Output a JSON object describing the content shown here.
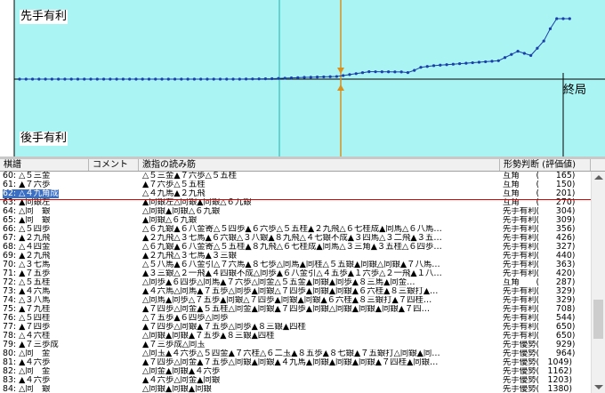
{
  "graph": {
    "top_label": "先手有利",
    "bottom_label": "後手有利",
    "end_label": "終局",
    "colors": {
      "plot_bg": "#aaf4f4",
      "line": "#1a3fa8",
      "marker": "#c84a10",
      "current": "#d8901e",
      "border": "#000000"
    }
  },
  "chart_data": {
    "type": "line",
    "x": [
      1,
      5,
      10,
      15,
      20,
      25,
      30,
      35,
      40,
      45,
      50,
      55,
      60,
      61,
      62,
      63,
      65,
      70,
      75,
      78,
      80,
      82,
      83,
      84,
      85
    ],
    "values": [
      0,
      0,
      0,
      0,
      0,
      0,
      0,
      0,
      10,
      40,
      60,
      170,
      165,
      150,
      201,
      270,
      308,
      363,
      420,
      636,
      540,
      870,
      1150,
      1380,
      1380
    ],
    "current_move": 62,
    "ylim": [
      -1400,
      1400
    ],
    "xlim": [
      0,
      86
    ]
  },
  "table": {
    "headers": {
      "move": "棋譜",
      "comment": "コメント",
      "read": "激指の読み筋",
      "eval": "形勢判断 (評価値)"
    },
    "rows": [
      {
        "move": "60: △５三金",
        "read": "△５三金▲７六歩△５五桂",
        "eval": "互角　　(　　165)"
      },
      {
        "move": "61: ▲７六歩",
        "read": "▲７六歩△５五桂",
        "eval": "互角　　(　　150)"
      },
      {
        "move": "62: △４九角成",
        "read": "△４九馬▲２九飛",
        "eval": "互角　　(　　201)",
        "selected": true
      },
      {
        "move": "63: ▲同銀左",
        "read": "▲同銀左△同銀▲同銀△６九銀",
        "eval": "互角　　(　　270)"
      },
      {
        "move": "64: △同　銀",
        "read": "△同銀▲同銀△６九銀",
        "eval": "先手有利(　　304)"
      },
      {
        "move": "65: ▲同　銀",
        "read": "▲同銀△６九銀",
        "eval": "先手有利(　　309)"
      },
      {
        "move": "66: △５四歩",
        "read": "△６九銀▲６八金寄△５四歩▲６六歩△５五桂▲２九飛△６七桂成▲同馬△６八馬…",
        "eval": "先手有利(　　356)"
      },
      {
        "move": "67: ▲２九飛",
        "read": "▲２九飛△３七馬▲６六銀△３八銀▲８九飛△４七銀不成▲３四馬△３二飛▲３五…",
        "eval": "先手有利(　　426)"
      },
      {
        "move": "68: △４四金",
        "read": "△６九銀▲６八金寄△５五桂▲８九飛△６七桂成▲同馬△３三角▲３五桂△６四歩…",
        "eval": "先手有利(　　327)"
      },
      {
        "move": "69: ▲２九飛",
        "read": "▲２九飛△３七馬▲３三銀",
        "eval": "先手有利(　　440)"
      },
      {
        "move": "70: △３七馬",
        "read": "△５八馬▲６八金引△７六馬▲８七歩△同馬▲同桂△５五銀▲同銀△同銀▲７八馬…",
        "eval": "先手有利(　　363)"
      },
      {
        "move": "71: ▲７五歩",
        "read": "▲３三銀△２一飛▲４四銀不成△同歩▲６八金引△４五歩▲１六歩△２一飛▲１八…",
        "eval": "先手有利(　　420)"
      },
      {
        "move": "72: △５五桂",
        "read": "△同歩▲６四歩△同馬▲７六歩△同金△５五金▲同銀▲同歩▲８三馬▲同金…",
        "eval": "互角　　(　　287)"
      },
      {
        "move": "73: ▲４六馬",
        "read": "▲４六馬△同馬▲７五歩△同歩▲同銀△７四歩▲同銀▲同銀▲６六桂▲８三銀打▲…",
        "eval": "先手有利(　　329)"
      },
      {
        "move": "74: △３八馬",
        "read": "△同馬▲同歩△７五歩▲同銀△７四歩▲同銀▲同銀▲６六桂▲８三銀打▲７四桂…",
        "eval": "先手有利(　　329)"
      },
      {
        "move": "75: ▲７九桂",
        "read": "▲７四歩△同金▲５五桂△同金▲同銀▲７四歩▲同銀△同銀▲同銀▲同銀▲７四…",
        "eval": "先手有利(　　708)"
      },
      {
        "move": "76: △５四桂",
        "read": "△７五歩▲６四歩△同歩",
        "eval": "先手有利(　　544)"
      },
      {
        "move": "77: ▲７四歩",
        "read": "▲７四歩△同銀▲７五歩△同歩▲８三銀▲四桂",
        "eval": "先手有利(　　650)"
      },
      {
        "move": "78: △４六桂",
        "read": "△同銀▲同銀▲７五歩▲８三銀▲四桂",
        "eval": "先手有利(　　650)"
      },
      {
        "move": "79: ▲７三歩成",
        "read": "▲７三歩成△同玉",
        "eval": "先手優勢(　　929)"
      },
      {
        "move": "80: △同　金",
        "read": "△同玉▲４六歩△５四金▲７六桂△６二玉▲８五歩▲８七銀▲７五銀打△同銀▲同…",
        "eval": "先手優勢(　　964)"
      },
      {
        "move": "81: ▲４六歩",
        "read": "▲７四歩△同金▲７五歩△同銀▲同銀▲４九馬▲同銀▲同銀▲同銀▲７四桂▲同銀…",
        "eval": "先手優勢(　1049)"
      },
      {
        "move": "82: △同　金",
        "read": "△同金▲同銀▲４六歩",
        "eval": "先手優勢(　1162)"
      },
      {
        "move": "83: ▲４六歩",
        "read": "▲４六歩△同金▲同銀",
        "eval": "先手優勢(　1203)"
      },
      {
        "move": "84: △同　銀",
        "read": "△同銀▲同銀▲同銀",
        "eval": "先手優勢(　1380)"
      }
    ]
  }
}
